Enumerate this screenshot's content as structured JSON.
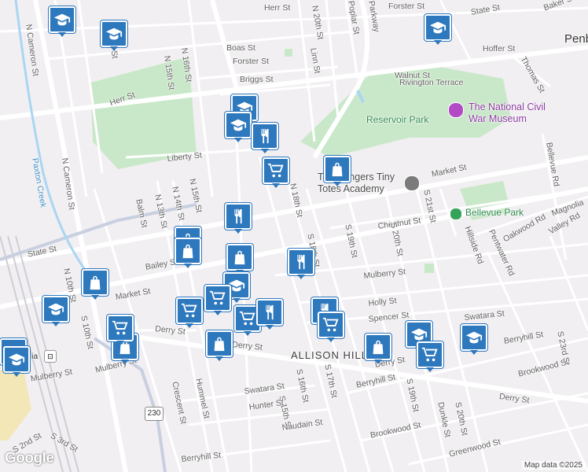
{
  "map": {
    "attribution": "Map data ©2025",
    "logo": "Google",
    "route_shield": "230"
  },
  "places": {
    "city": "Penb",
    "neighborhood": "ALLISON HILL",
    "reservoir_park": "Reservoir Park",
    "bellevue_park": "Bellevue Park",
    "museum": "The National Civil\nWar Museum",
    "academy": "The Bangers Tiny\nTotes Academy",
    "paxton_creek": "Paxton Creek",
    "city_cut": "ia"
  },
  "streets": [
    "Herr St",
    "Herr St",
    "Forster St",
    "Boas St",
    "Forster St",
    "Briggs St",
    "N 20th St",
    "Poplar St",
    "Parkway",
    "Linn St",
    "Walnut St",
    "Rivington Terrace",
    "Hoffer St",
    "Thomas St",
    "State St",
    "Baker St",
    "Liberty St",
    "Market St",
    "Market St",
    "State St",
    "N Cameron St",
    "N Cameron St",
    "N 14th St",
    "N 15th St",
    "N 16th St",
    "N 18th St",
    "N 13th St",
    "N 14th St",
    "N 15th St",
    "Balm St",
    "Bailey St",
    "Chestnut St",
    "Mulberry St",
    "Mulberry St",
    "Holly St",
    "Spencer St",
    "Swatara St",
    "Derry St",
    "Derry St",
    "Derry St",
    "Derry St",
    "Berryhill St",
    "Berryhill St",
    "Brookwood St",
    "Brookwood St",
    "Greenwood St",
    "S 17th St",
    "S 18th St",
    "S 19th St",
    "S 20th St",
    "S 21st St",
    "S 19th St",
    "S 20th St",
    "S 15th St",
    "S 16th St",
    "Hunter St",
    "Swatara St",
    "Naudain St",
    "Crescent St",
    "Hummel St",
    "Berryhill St",
    "N 10th St",
    "S 10th St",
    "Mulberry St",
    "Hillside Rd",
    "Pentwater Rd",
    "Oakwood Rd",
    "Valley Rd",
    "Magnolia",
    "Bellevue Rd",
    "Dunkle St",
    "S 23rd St",
    "S 2nd St",
    "S 3rd St"
  ],
  "pins": [
    {
      "type": "school"
    },
    {
      "type": "school"
    },
    {
      "type": "school"
    },
    {
      "type": "school"
    },
    {
      "type": "school"
    },
    {
      "type": "school"
    },
    {
      "type": "restaurant"
    },
    {
      "type": "grocery"
    },
    {
      "type": "store"
    },
    {
      "type": "restaurant"
    },
    {
      "type": "store"
    },
    {
      "type": "store"
    },
    {
      "type": "store"
    },
    {
      "type": "restaurant"
    },
    {
      "type": "school"
    },
    {
      "type": "grocery"
    },
    {
      "type": "grocery"
    },
    {
      "type": "grocery"
    },
    {
      "type": "restaurant"
    },
    {
      "type": "restaurant"
    },
    {
      "type": "grocery"
    },
    {
      "type": "store"
    },
    {
      "type": "store"
    },
    {
      "type": "store"
    },
    {
      "type": "grocery"
    },
    {
      "type": "store"
    },
    {
      "type": "school"
    },
    {
      "type": "grocery"
    },
    {
      "type": "school"
    },
    {
      "type": "school"
    },
    {
      "type": "school"
    }
  ]
}
